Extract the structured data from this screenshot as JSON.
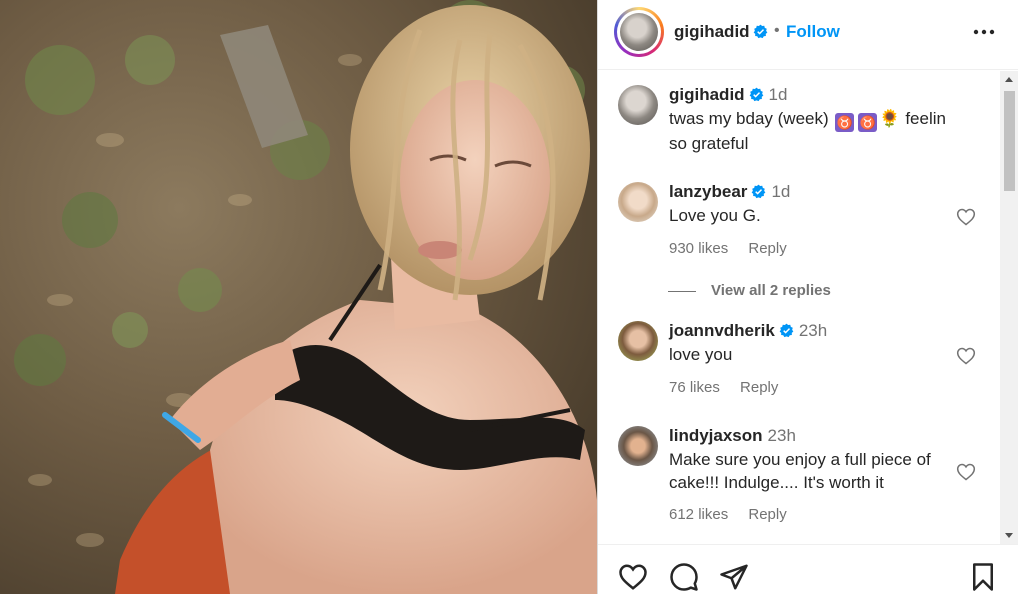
{
  "post": {
    "author": "gigihadid",
    "follow_label": "Follow",
    "separator": "•",
    "caption": {
      "username": "gigihadid",
      "time": "1d",
      "text_before": "twas my bday (week)",
      "emoji_1": "♉",
      "emoji_2": "♉",
      "emoji_3": "🌻",
      "text_after": "feelin so grateful"
    }
  },
  "comments": [
    {
      "username": "lanzybear",
      "verified": true,
      "time": "1d",
      "text": "Love you G.",
      "likes": "930 likes",
      "reply_label": "Reply"
    },
    {
      "username": "joannvdherik",
      "verified": true,
      "time": "23h",
      "text": "love you",
      "likes": "76 likes",
      "reply_label": "Reply"
    },
    {
      "username": "lindyjaxson",
      "verified": false,
      "time": "23h",
      "text": "Make sure you enjoy a full piece of cake!!! Indulge.... It's worth it",
      "likes": "612 likes",
      "reply_label": "Reply"
    }
  ],
  "view_replies_label": "View all 2 replies",
  "icons": {
    "verified": "verified-badge-icon",
    "more": "more-options-icon",
    "like": "heart-icon",
    "comment": "comment-bubble-icon",
    "share": "paper-plane-icon",
    "save": "bookmark-icon"
  },
  "colors": {
    "accent": "#0095f6",
    "verified": "#0095f6",
    "text": "#262626",
    "muted": "#737373"
  }
}
